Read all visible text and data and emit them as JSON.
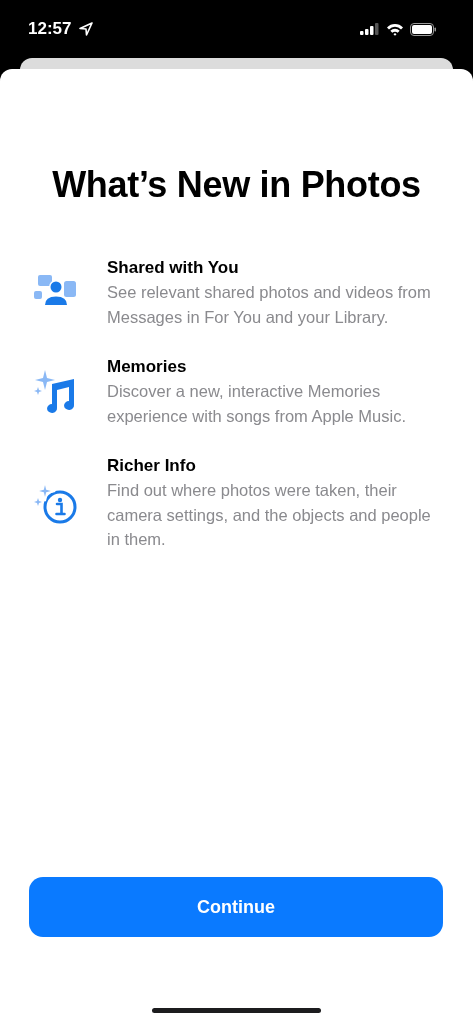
{
  "status_bar": {
    "time": "12:57"
  },
  "title": "What’s New in Photos",
  "features": [
    {
      "kind": "shared",
      "title": "Shared with You",
      "description": "See relevant shared photos and videos from Messages in For You and your Library."
    },
    {
      "kind": "music",
      "title": "Memories",
      "description": "Discover a new, interactive Memories experience with songs from Apple Music."
    },
    {
      "kind": "info",
      "title": "Richer Info",
      "description": "Find out where photos were taken, their camera settings, and the objects and people in them."
    }
  ],
  "button": "Continue"
}
